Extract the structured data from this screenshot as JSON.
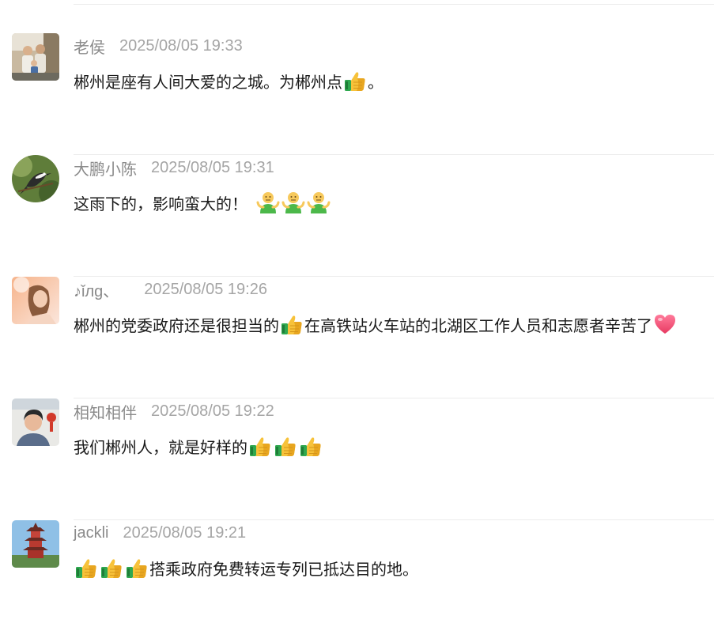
{
  "comments": [
    {
      "nick": "老侯",
      "time": "2025/08/05 19:33",
      "parts": [
        "郴州是座有人间大爱的之城。为郴州点",
        "。"
      ],
      "emojis": [
        "thumbs-up"
      ]
    },
    {
      "nick": "大鹏小陈",
      "time": "2025/08/05 19:31",
      "parts": [
        "这雨下的，影响蛮大的！"
      ],
      "emojis": [
        "shrug-person",
        "shrug-person",
        "shrug-person"
      ]
    },
    {
      "nick": "♪ǐлg、",
      "time": "2025/08/05 19:26",
      "parts": [
        "郴州的党委政府还是很担当的",
        "在高铁站火车站的北湖区工作人员和志愿者辛苦了"
      ],
      "emojis": [
        "thumbs-up",
        "heart"
      ]
    },
    {
      "nick": "相知相伴",
      "time": "2025/08/05 19:22",
      "parts": [
        "我们郴州人，就是好样的"
      ],
      "emojis": [
        "thumbs-up",
        "thumbs-up",
        "thumbs-up"
      ]
    },
    {
      "nick": "jackli",
      "time": "2025/08/05 19:21",
      "parts": [
        "搭乘政府免费转运专列已抵达目的地。"
      ],
      "emojis": [
        "thumbs-up",
        "thumbs-up",
        "thumbs-up"
      ]
    }
  ]
}
